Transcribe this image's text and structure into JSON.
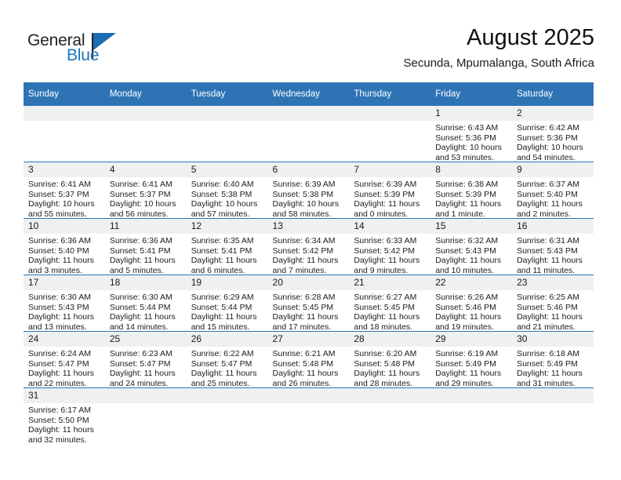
{
  "branding": {
    "logo_text_1": "General",
    "logo_text_2": "Blue",
    "logo_icon": "flag-icon",
    "accent_color": "#1b75bb"
  },
  "header": {
    "title": "August 2025",
    "subtitle": "Secunda, Mpumalanga, South Africa"
  },
  "colors": {
    "header_row_bg": "#2e74b5",
    "header_row_text": "#ffffff",
    "daynum_band_bg": "#f0f0f0",
    "row_divider": "#2e74b5",
    "cell_text": "#1c1c1c"
  },
  "weekday_headers": [
    "Sunday",
    "Monday",
    "Tuesday",
    "Wednesday",
    "Thursday",
    "Friday",
    "Saturday"
  ],
  "weeks": [
    [
      {
        "day": "",
        "lines": []
      },
      {
        "day": "",
        "lines": []
      },
      {
        "day": "",
        "lines": []
      },
      {
        "day": "",
        "lines": []
      },
      {
        "day": "",
        "lines": []
      },
      {
        "day": "1",
        "lines": [
          "Sunrise: 6:43 AM",
          "Sunset: 5:36 PM",
          "Daylight: 10 hours",
          "and 53 minutes."
        ]
      },
      {
        "day": "2",
        "lines": [
          "Sunrise: 6:42 AM",
          "Sunset: 5:36 PM",
          "Daylight: 10 hours",
          "and 54 minutes."
        ]
      }
    ],
    [
      {
        "day": "3",
        "lines": [
          "Sunrise: 6:41 AM",
          "Sunset: 5:37 PM",
          "Daylight: 10 hours",
          "and 55 minutes."
        ]
      },
      {
        "day": "4",
        "lines": [
          "Sunrise: 6:41 AM",
          "Sunset: 5:37 PM",
          "Daylight: 10 hours",
          "and 56 minutes."
        ]
      },
      {
        "day": "5",
        "lines": [
          "Sunrise: 6:40 AM",
          "Sunset: 5:38 PM",
          "Daylight: 10 hours",
          "and 57 minutes."
        ]
      },
      {
        "day": "6",
        "lines": [
          "Sunrise: 6:39 AM",
          "Sunset: 5:38 PM",
          "Daylight: 10 hours",
          "and 58 minutes."
        ]
      },
      {
        "day": "7",
        "lines": [
          "Sunrise: 6:39 AM",
          "Sunset: 5:39 PM",
          "Daylight: 11 hours",
          "and 0 minutes."
        ]
      },
      {
        "day": "8",
        "lines": [
          "Sunrise: 6:38 AM",
          "Sunset: 5:39 PM",
          "Daylight: 11 hours",
          "and 1 minute."
        ]
      },
      {
        "day": "9",
        "lines": [
          "Sunrise: 6:37 AM",
          "Sunset: 5:40 PM",
          "Daylight: 11 hours",
          "and 2 minutes."
        ]
      }
    ],
    [
      {
        "day": "10",
        "lines": [
          "Sunrise: 6:36 AM",
          "Sunset: 5:40 PM",
          "Daylight: 11 hours",
          "and 3 minutes."
        ]
      },
      {
        "day": "11",
        "lines": [
          "Sunrise: 6:36 AM",
          "Sunset: 5:41 PM",
          "Daylight: 11 hours",
          "and 5 minutes."
        ]
      },
      {
        "day": "12",
        "lines": [
          "Sunrise: 6:35 AM",
          "Sunset: 5:41 PM",
          "Daylight: 11 hours",
          "and 6 minutes."
        ]
      },
      {
        "day": "13",
        "lines": [
          "Sunrise: 6:34 AM",
          "Sunset: 5:42 PM",
          "Daylight: 11 hours",
          "and 7 minutes."
        ]
      },
      {
        "day": "14",
        "lines": [
          "Sunrise: 6:33 AM",
          "Sunset: 5:42 PM",
          "Daylight: 11 hours",
          "and 9 minutes."
        ]
      },
      {
        "day": "15",
        "lines": [
          "Sunrise: 6:32 AM",
          "Sunset: 5:43 PM",
          "Daylight: 11 hours",
          "and 10 minutes."
        ]
      },
      {
        "day": "16",
        "lines": [
          "Sunrise: 6:31 AM",
          "Sunset: 5:43 PM",
          "Daylight: 11 hours",
          "and 11 minutes."
        ]
      }
    ],
    [
      {
        "day": "17",
        "lines": [
          "Sunrise: 6:30 AM",
          "Sunset: 5:43 PM",
          "Daylight: 11 hours",
          "and 13 minutes."
        ]
      },
      {
        "day": "18",
        "lines": [
          "Sunrise: 6:30 AM",
          "Sunset: 5:44 PM",
          "Daylight: 11 hours",
          "and 14 minutes."
        ]
      },
      {
        "day": "19",
        "lines": [
          "Sunrise: 6:29 AM",
          "Sunset: 5:44 PM",
          "Daylight: 11 hours",
          "and 15 minutes."
        ]
      },
      {
        "day": "20",
        "lines": [
          "Sunrise: 6:28 AM",
          "Sunset: 5:45 PM",
          "Daylight: 11 hours",
          "and 17 minutes."
        ]
      },
      {
        "day": "21",
        "lines": [
          "Sunrise: 6:27 AM",
          "Sunset: 5:45 PM",
          "Daylight: 11 hours",
          "and 18 minutes."
        ]
      },
      {
        "day": "22",
        "lines": [
          "Sunrise: 6:26 AM",
          "Sunset: 5:46 PM",
          "Daylight: 11 hours",
          "and 19 minutes."
        ]
      },
      {
        "day": "23",
        "lines": [
          "Sunrise: 6:25 AM",
          "Sunset: 5:46 PM",
          "Daylight: 11 hours",
          "and 21 minutes."
        ]
      }
    ],
    [
      {
        "day": "24",
        "lines": [
          "Sunrise: 6:24 AM",
          "Sunset: 5:47 PM",
          "Daylight: 11 hours",
          "and 22 minutes."
        ]
      },
      {
        "day": "25",
        "lines": [
          "Sunrise: 6:23 AM",
          "Sunset: 5:47 PM",
          "Daylight: 11 hours",
          "and 24 minutes."
        ]
      },
      {
        "day": "26",
        "lines": [
          "Sunrise: 6:22 AM",
          "Sunset: 5:47 PM",
          "Daylight: 11 hours",
          "and 25 minutes."
        ]
      },
      {
        "day": "27",
        "lines": [
          "Sunrise: 6:21 AM",
          "Sunset: 5:48 PM",
          "Daylight: 11 hours",
          "and 26 minutes."
        ]
      },
      {
        "day": "28",
        "lines": [
          "Sunrise: 6:20 AM",
          "Sunset: 5:48 PM",
          "Daylight: 11 hours",
          "and 28 minutes."
        ]
      },
      {
        "day": "29",
        "lines": [
          "Sunrise: 6:19 AM",
          "Sunset: 5:49 PM",
          "Daylight: 11 hours",
          "and 29 minutes."
        ]
      },
      {
        "day": "30",
        "lines": [
          "Sunrise: 6:18 AM",
          "Sunset: 5:49 PM",
          "Daylight: 11 hours",
          "and 31 minutes."
        ]
      }
    ],
    [
      {
        "day": "31",
        "lines": [
          "Sunrise: 6:17 AM",
          "Sunset: 5:50 PM",
          "Daylight: 11 hours",
          "and 32 minutes."
        ]
      },
      {
        "day": "",
        "lines": []
      },
      {
        "day": "",
        "lines": []
      },
      {
        "day": "",
        "lines": []
      },
      {
        "day": "",
        "lines": []
      },
      {
        "day": "",
        "lines": []
      },
      {
        "day": "",
        "lines": []
      }
    ]
  ]
}
